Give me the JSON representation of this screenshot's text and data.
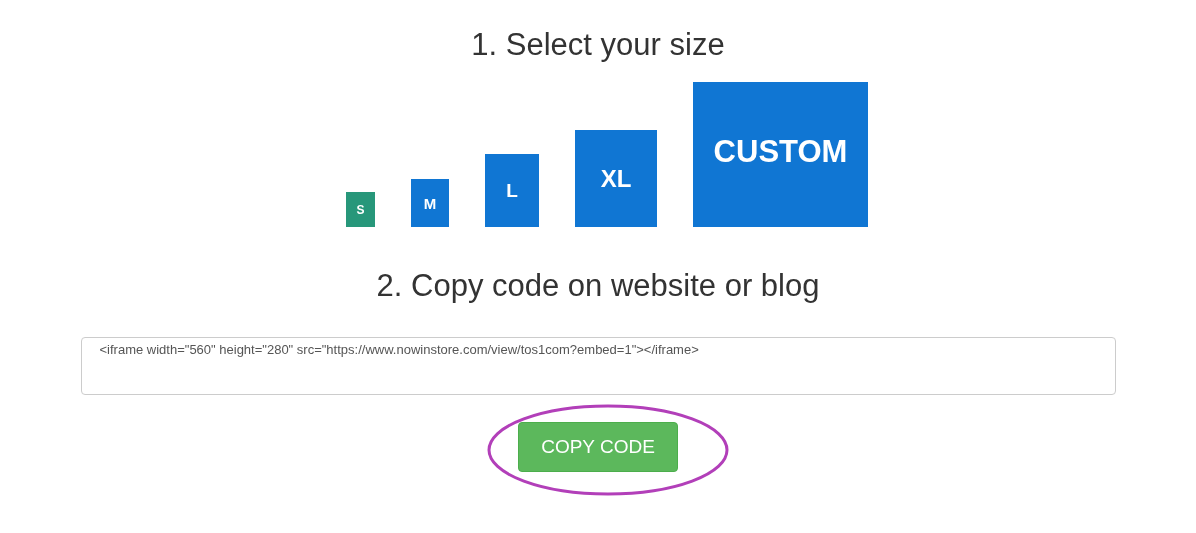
{
  "step1_title": "1. Select your size",
  "sizes": [
    {
      "label": "S",
      "selected": true
    },
    {
      "label": "M",
      "selected": false
    },
    {
      "label": "L",
      "selected": false
    },
    {
      "label": "XL",
      "selected": false
    },
    {
      "label": "CUSTOM",
      "selected": false
    }
  ],
  "step2_title": "2. Copy code on website or blog",
  "code_field": {
    "value": "<iframe width=\"560\" height=\"280\" src=\"https://www.nowinstore.com/view/tos1com?embed=1\"></iframe>"
  },
  "copy_button": {
    "label": "COPY CODE",
    "highlighted": true
  }
}
